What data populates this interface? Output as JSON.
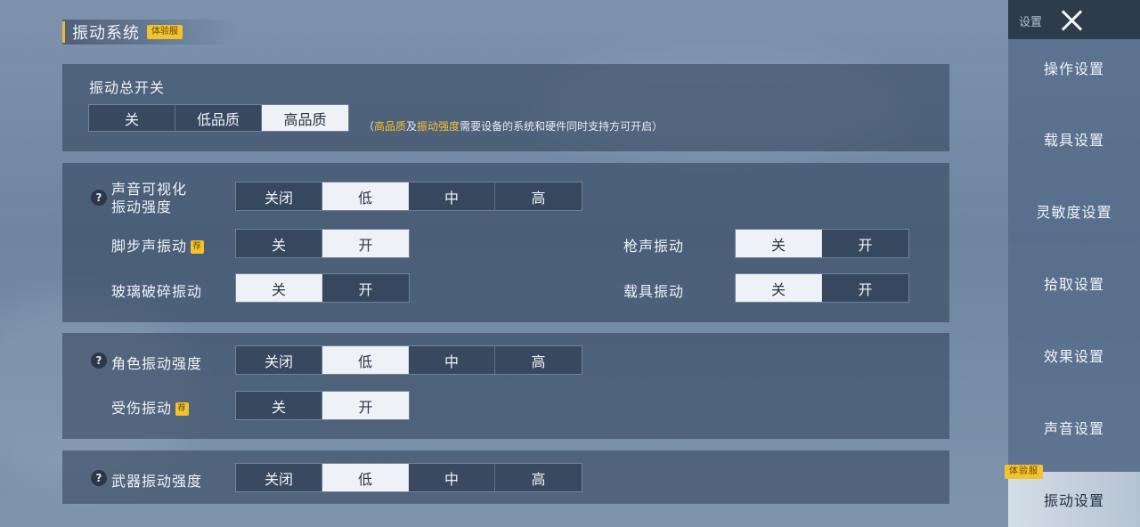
{
  "header": {
    "title": "振动系统",
    "badge": "体验服"
  },
  "master": {
    "label": "振动总开关",
    "options": [
      "关",
      "低品质",
      "高品质"
    ],
    "selected": 2,
    "note": {
      "open": "（",
      "hl1": "高品质",
      "mid": "及",
      "hl2": "振动强度",
      "rest": "需要设备的系统和硬件同时支持方可开启",
      "close": "）"
    }
  },
  "sound": {
    "label": "声音可视化\n振动强度",
    "options": [
      "关闭",
      "低",
      "中",
      "高"
    ],
    "selected": 1,
    "footstep": {
      "label": "脚步声振动",
      "badge": "荐",
      "options": [
        "关",
        "开"
      ],
      "selected": 1
    },
    "glass": {
      "label": "玻璃破碎振动",
      "options": [
        "关",
        "开"
      ],
      "selected": 0
    },
    "gunshot": {
      "label": "枪声振动",
      "options": [
        "关",
        "开"
      ],
      "selected": 0
    },
    "vehicle": {
      "label": "载具振动",
      "options": [
        "关",
        "开"
      ],
      "selected": 0
    }
  },
  "character": {
    "label": "角色振动强度",
    "options": [
      "关闭",
      "低",
      "中",
      "高"
    ],
    "selected": 1,
    "hurt": {
      "label": "受伤振动",
      "badge": "荐",
      "options": [
        "关",
        "开"
      ],
      "selected": 1
    }
  },
  "weapon": {
    "label": "武器振动强度",
    "options": [
      "关闭",
      "低",
      "中",
      "高"
    ],
    "selected": 1
  },
  "help_glyph": "?",
  "sidebar": {
    "title": "设置",
    "items": [
      "操作设置",
      "载具设置",
      "灵敏度设置",
      "拾取设置",
      "效果设置",
      "声音设置",
      "振动设置"
    ],
    "active_badge": "体验服"
  },
  "colors": {
    "accent": "#f2c230",
    "selected_bg": "#eef1f5",
    "panel_bg": "#2d3e56"
  }
}
